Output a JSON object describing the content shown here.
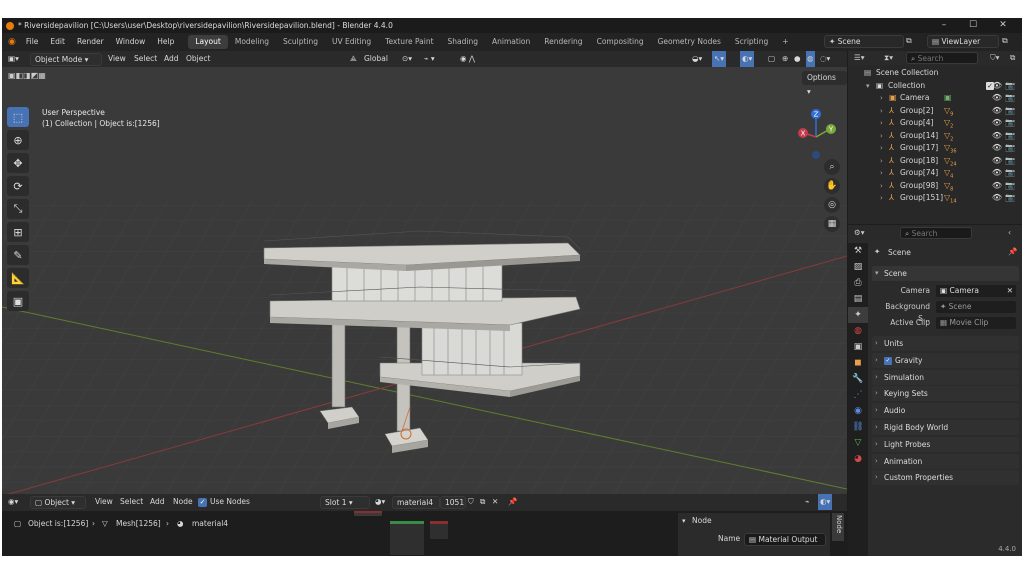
{
  "titlebar": {
    "title": "* Riversidepavilion [C:\\Users\\user\\Desktop\\riversidepavilion\\Riversidepavilion.blend] - Blender 4.4.0"
  },
  "menubar": {
    "menus": [
      "File",
      "Edit",
      "Render",
      "Window",
      "Help"
    ],
    "workspaces": [
      "Layout",
      "Modeling",
      "Sculpting",
      "UV Editing",
      "Texture Paint",
      "Shading",
      "Animation",
      "Rendering",
      "Compositing",
      "Geometry Nodes",
      "Scripting"
    ],
    "active_workspace": "Layout",
    "add_tab": "+",
    "scene": "Scene",
    "view_layer": "ViewLayer"
  },
  "viewport": {
    "mode": "Object Mode",
    "menus": [
      "View",
      "Select",
      "Add",
      "Object"
    ],
    "transform_orientation": "Global",
    "options_label": "Options",
    "perspective": "User Perspective",
    "collection_info": "(1) Collection | Object is:[1256]",
    "gizmo_axes": {
      "z": "Z",
      "y": "Y",
      "x": "X"
    },
    "colors": {
      "x_axis": "#8a3a3a",
      "y_axis": "#5f7f2e",
      "accent": "#4772b3"
    }
  },
  "outliner": {
    "search_placeholder": "Search",
    "root": "Scene Collection",
    "collection": "Collection",
    "items": [
      {
        "name": "Camera",
        "icon": "camera-icon",
        "badge": ""
      },
      {
        "name": "Group[2]",
        "icon": "empty-icon",
        "badge": "9"
      },
      {
        "name": "Group[4]",
        "icon": "empty-icon",
        "badge": "2"
      },
      {
        "name": "Group[14]",
        "icon": "empty-icon",
        "badge": "2"
      },
      {
        "name": "Group[17]",
        "icon": "empty-icon",
        "badge": "36"
      },
      {
        "name": "Group[18]",
        "icon": "empty-icon",
        "badge": "24"
      },
      {
        "name": "Group[74]",
        "icon": "empty-icon",
        "badge": "4"
      },
      {
        "name": "Group[98]",
        "icon": "empty-icon",
        "badge": "8"
      },
      {
        "name": "Group[151]",
        "icon": "empty-icon",
        "badge": "14"
      }
    ]
  },
  "properties": {
    "search_placeholder": "Search",
    "context": "Scene",
    "scene_panel": {
      "title": "Scene",
      "camera_label": "Camera",
      "camera_value": "Camera",
      "background_label": "Background S...",
      "background_placeholder": "Scene",
      "active_clip_label": "Active Clip",
      "active_clip_placeholder": "Movie Clip"
    },
    "sections": [
      "Units",
      "Gravity",
      "Simulation",
      "Keying Sets",
      "Audio",
      "Rigid Body World",
      "Light Probes",
      "Animation",
      "Custom Properties"
    ]
  },
  "node_editor": {
    "mode": "Object",
    "menus": [
      "View",
      "Select",
      "Add",
      "Node"
    ],
    "use_nodes_label": "Use Nodes",
    "slot": "Slot 1",
    "material": "material4",
    "users": "1051",
    "breadcrumb": [
      "Object is:[1256]",
      "Mesh[1256]",
      "material4"
    ],
    "side_panel": {
      "header": "Node",
      "name_label": "Name",
      "name_value": "Material Output",
      "tab": "Node"
    }
  },
  "status": {
    "version": "4.4.0"
  }
}
